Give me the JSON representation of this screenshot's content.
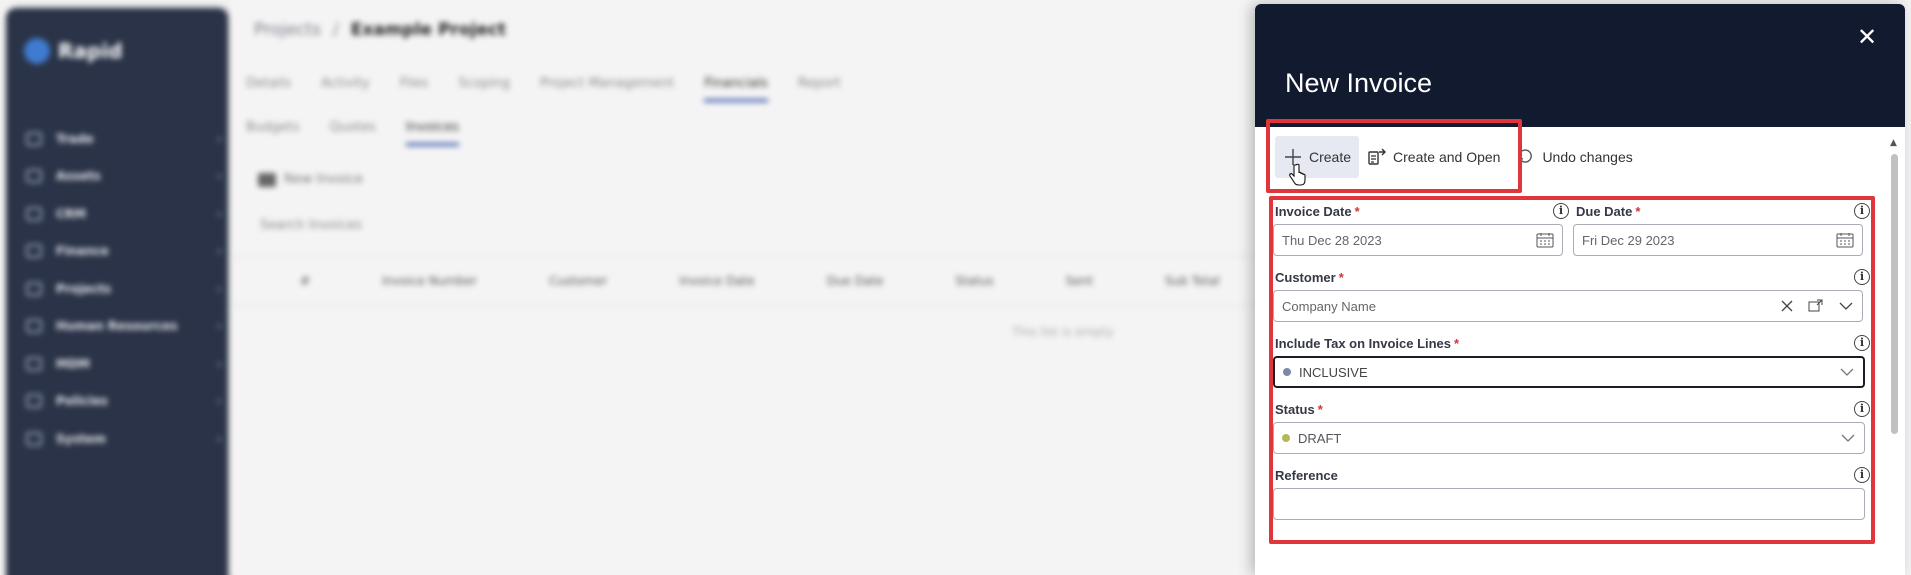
{
  "sidebar": {
    "logo": "Rapid",
    "items": [
      {
        "label": "Trade"
      },
      {
        "label": "Assets"
      },
      {
        "label": "CRM"
      },
      {
        "label": "Finance"
      },
      {
        "label": "Projects"
      },
      {
        "label": "Human Resources"
      },
      {
        "label": "MDM"
      },
      {
        "label": "Policies"
      },
      {
        "label": "System"
      }
    ]
  },
  "breadcrumb": {
    "parent": "Projects",
    "separator": "/",
    "current": "Example Project"
  },
  "tabs": [
    "Details",
    "Activity",
    "Files",
    "Scoping",
    "Project Management",
    "Financials",
    "Report"
  ],
  "subtabs": [
    "Budgets",
    "Quotes",
    "Invoices"
  ],
  "background": {
    "new_invoice_button": "New Invoice",
    "search_placeholder": "Search Invoices",
    "grid_columns": [
      "#",
      "Invoice Number",
      "Customer",
      "Invoice Date",
      "Due Date",
      "Status",
      "Sent",
      "Sub Total"
    ],
    "empty_message": "This list is empty"
  },
  "dialog": {
    "title": "New Invoice",
    "close_icon": "close-icon",
    "toolbar": {
      "create": "Create",
      "create_and_open": "Create and Open",
      "undo_changes": "Undo changes"
    },
    "form": {
      "invoice_date": {
        "label": "Invoice Date",
        "value": "Thu Dec 28 2023"
      },
      "due_date": {
        "label": "Due Date",
        "value": "Fri Dec 29 2023"
      },
      "customer": {
        "label": "Customer",
        "placeholder": "Company Name"
      },
      "include_tax": {
        "label": "Include Tax on Invoice Lines",
        "value": "INCLUSIVE",
        "dot_color": "#7b8aa8"
      },
      "status": {
        "label": "Status",
        "value": "DRAFT",
        "dot_color": "#b5b85a"
      },
      "reference": {
        "label": "Reference",
        "value": ""
      }
    },
    "required_marker": "*",
    "highlight_color": "#e0353a"
  }
}
